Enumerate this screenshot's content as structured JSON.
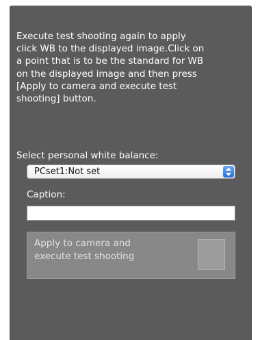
{
  "panel": {
    "instructions": "Execute test shooting again to apply\nclick WB to the displayed image.Click on\na point that is to be the standard for WB\non the displayed image and then press\n[Apply to camera and execute test\nshooting] button.",
    "white_balance_label": "Select personal white balance:",
    "white_balance_value": "PCset1:Not set",
    "caption_label": "Caption:",
    "caption_value": "",
    "apply_button_label": "Apply to camera and\nexecute test shooting"
  }
}
